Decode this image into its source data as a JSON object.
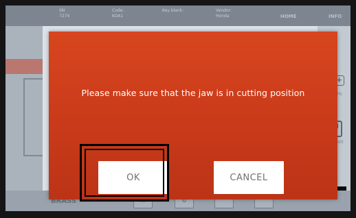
{
  "topbar": {
    "cells": [
      {
        "top": "SN",
        "bottom": "7274"
      },
      {
        "top": "Code:",
        "bottom": "KOA1"
      },
      {
        "top": "Key blank:",
        "bottom": ""
      },
      {
        "top": "Vendor:",
        "bottom": "Honda"
      }
    ],
    "tabs": [
      "HOME",
      "INFO"
    ]
  },
  "right_panel": {
    "zoom_out_icon": "zoom-out-icon",
    "zoom_in_icon": "zoom-in-icon",
    "zoom_percent": "0%",
    "save_label": "SAVE"
  },
  "bottombar": {
    "material": "BRASS",
    "buttons": [
      "x",
      "0",
      "",
      ""
    ]
  },
  "modal": {
    "message": "Please make sure that the jaw is in cutting position",
    "ok_label": "OK",
    "cancel_label": "CANCEL",
    "color": "#cf3f1c"
  }
}
